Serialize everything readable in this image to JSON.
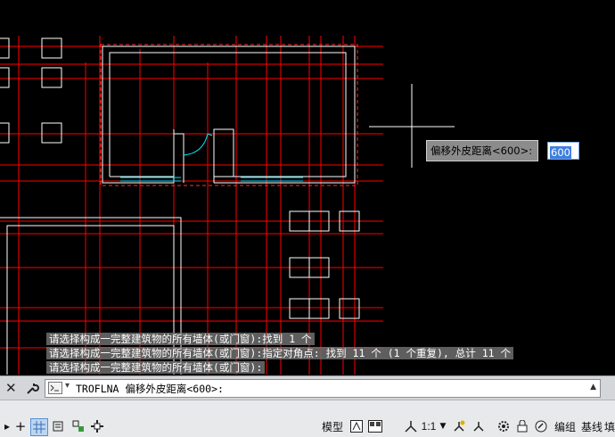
{
  "command_history": [
    "请选择构成一完整建筑物的所有墙体(或门窗):找到 1 个",
    "请选择构成一完整建筑物的所有墙体(或门窗):指定对角点: 找到 11 个 (1 个重复), 总计 11 个",
    "请选择构成一完整建筑物的所有墙体(或门窗):"
  ],
  "command_line": {
    "current_command": "TROFLNA 偏移外皮距离<600>:"
  },
  "dynamic_input": {
    "prompt": "偏移外皮距离<600>:",
    "value": "600"
  },
  "status_bar": {
    "model_label": "模型",
    "scale_label": "1:1",
    "edit_label": "编组",
    "baseline_label": "基线",
    "fill_label": "填"
  },
  "colors": {
    "axis_lines": "#ff0000",
    "walls": "#ffffff",
    "door_window": "#00e5ff",
    "selection_dashed": "#ff3030",
    "background": "#000000"
  }
}
